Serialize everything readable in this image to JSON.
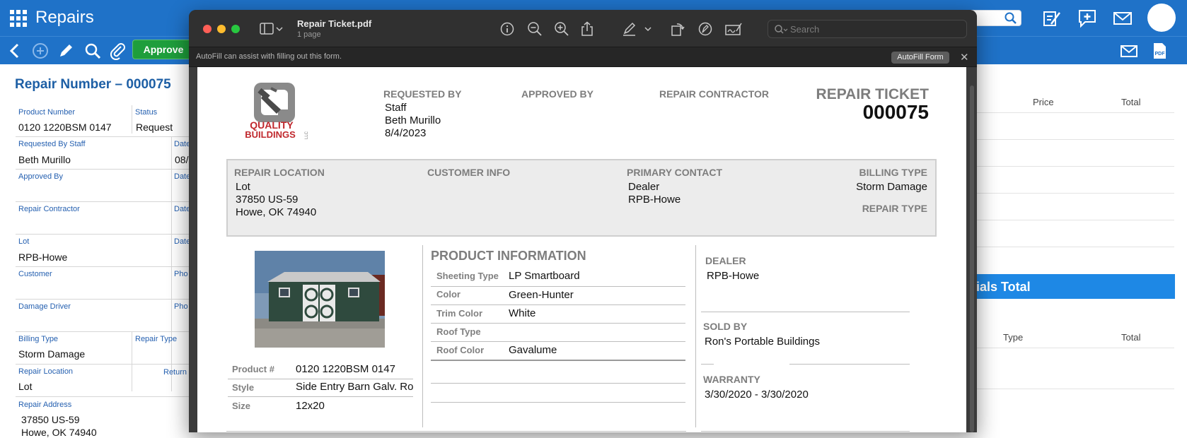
{
  "app": {
    "title": "Repairs",
    "toolbar": {
      "approve_label": "Approve"
    },
    "form": {
      "repair_number": "Repair Number – 000075",
      "product_number_label": "Product Number",
      "product_number": "0120 1220BSM 0147",
      "status_label": "Status",
      "status": "Request",
      "requested_by_label": "Requested By Staff",
      "requested_by": "Beth Murillo",
      "date_label": "Date",
      "date_value_partial": "08/",
      "approved_by_label": "Approved By",
      "repair_contractor_label": "Repair Contractor",
      "lot_label": "Lot",
      "lot": "RPB-Howe",
      "customer_label": "Customer",
      "phone_label": "Pho",
      "damage_driver_label": "Damage Driver",
      "billing_type_label": "Billing Type",
      "billing_type": "Storm Damage",
      "repair_type_label": "Repair Type",
      "repair_location_label": "Repair Location",
      "repair_location": "Lot",
      "return_label": "Return",
      "repair_address_label": "Repair Address",
      "repair_address_line1": "37850 US-59",
      "repair_address_line2": "Howe, OK 74940"
    },
    "right_table": {
      "price_header": "Price",
      "total_header": "Total",
      "materials_total": "ials Total",
      "type_header": "Type",
      "total_header2": "Total"
    }
  },
  "preview": {
    "doc_title": "Repair Ticket.pdf",
    "doc_pages": "1 page",
    "search_placeholder": "Search",
    "autofill_message": "AutoFill can assist with filling out this form.",
    "autofill_button": "AutoFill Form",
    "autofill_close": "✕"
  },
  "ticket": {
    "logo_text_top": "QUALITY",
    "logo_text_bottom": "BUILDINGS",
    "logo_suffix": "LLC",
    "requested_by_head": "REQUESTED BY",
    "requested_by_role": "Staff",
    "requested_by_name": "Beth Murillo",
    "requested_by_date": "8/4/2023",
    "approved_by_head": "APPROVED BY",
    "repair_contractor_head": "REPAIR CONTRACTOR",
    "ticket_title": "REPAIR TICKET",
    "ticket_number": "000075",
    "repair_location_head": "REPAIR LOCATION",
    "repair_location_line1": "Lot",
    "repair_location_line2": "37850 US-59",
    "repair_location_line3": "Howe, OK 74940",
    "customer_info_head": "CUSTOMER INFO",
    "primary_contact_head": "PRIMARY CONTACT",
    "primary_contact_line1": "Dealer",
    "primary_contact_line2": "RPB-Howe",
    "billing_type_head": "BILLING TYPE",
    "billing_type": "Storm Damage",
    "repair_type_head": "REPAIR TYPE",
    "product_info_head": "PRODUCT INFORMATION",
    "product_rows": [
      {
        "label": "Sheeting Type",
        "value": "LP Smartboard"
      },
      {
        "label": "Color",
        "value": "Green-Hunter"
      },
      {
        "label": "Trim Color",
        "value": "White"
      },
      {
        "label": "Roof Type",
        "value": ""
      },
      {
        "label": "Roof Color",
        "value": "Gavalume"
      }
    ],
    "product_num_label": "Product #",
    "product_num": "0120 1220BSM 0147",
    "style_label": "Style",
    "style": "Side Entry Barn Galv. Roof",
    "size_label": "Size",
    "size": "12x20",
    "dealer_head": "DEALER",
    "dealer": "RPB-Howe",
    "sold_by_head": "SOLD BY",
    "sold_by": "Ron's Portable Buildings",
    "warranty_head": "WARRANTY",
    "warranty": "3/30/2020 - 3/30/2020"
  },
  "colors": {
    "app_blue": "#1f72c8",
    "approve_green": "#1e9e3c",
    "label_blue": "#2560b0",
    "logo_red": "#c0282d",
    "logo_gray": "#7a7a7a",
    "shed_green": "#2f4a3e"
  }
}
